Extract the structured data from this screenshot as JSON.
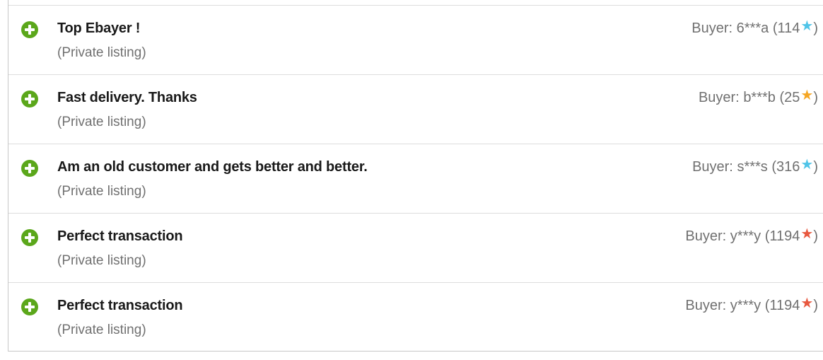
{
  "feedback": {
    "items": [
      {
        "rating_icon": "plus-circle-icon",
        "comment": "Top Ebayer !",
        "listing": "(Private listing)",
        "buyer_label": "Buyer:",
        "buyer_id": "6***a",
        "score_open": "(114",
        "star_icon": "star-icon",
        "star_glyph": "★",
        "star_color": "#4fc4e8",
        "score_close": ")"
      },
      {
        "rating_icon": "plus-circle-icon",
        "comment": "Fast delivery. Thanks",
        "listing": "(Private listing)",
        "buyer_label": "Buyer:",
        "buyer_id": "b***b",
        "score_open": "(25",
        "star_icon": "star-icon",
        "star_glyph": "★",
        "star_color": "#f5a623",
        "score_close": ")"
      },
      {
        "rating_icon": "plus-circle-icon",
        "comment": "Am an old customer and gets better and better.",
        "listing": "(Private listing)",
        "buyer_label": "Buyer:",
        "buyer_id": "s***s",
        "score_open": "(316",
        "star_icon": "star-icon",
        "star_glyph": "★",
        "star_color": "#4fc4e8",
        "score_close": ")"
      },
      {
        "rating_icon": "plus-circle-icon",
        "comment": "Perfect transaction",
        "listing": "(Private listing)",
        "buyer_label": "Buyer:",
        "buyer_id": "y***y",
        "score_open": "(1194",
        "star_icon": "star-icon",
        "star_glyph": "★",
        "star_color": "#e8583f",
        "score_close": ")"
      },
      {
        "rating_icon": "plus-circle-icon",
        "comment": "Perfect transaction",
        "listing": "(Private listing)",
        "buyer_label": "Buyer:",
        "buyer_id": "y***y",
        "score_open": "(1194",
        "star_icon": "star-icon",
        "star_glyph": "★",
        "star_color": "#e8583f",
        "score_close": ")"
      }
    ]
  },
  "colors": {
    "positive": "#5ba71b",
    "text_primary": "#191919",
    "text_secondary": "#707070",
    "divider": "#dddddd"
  }
}
